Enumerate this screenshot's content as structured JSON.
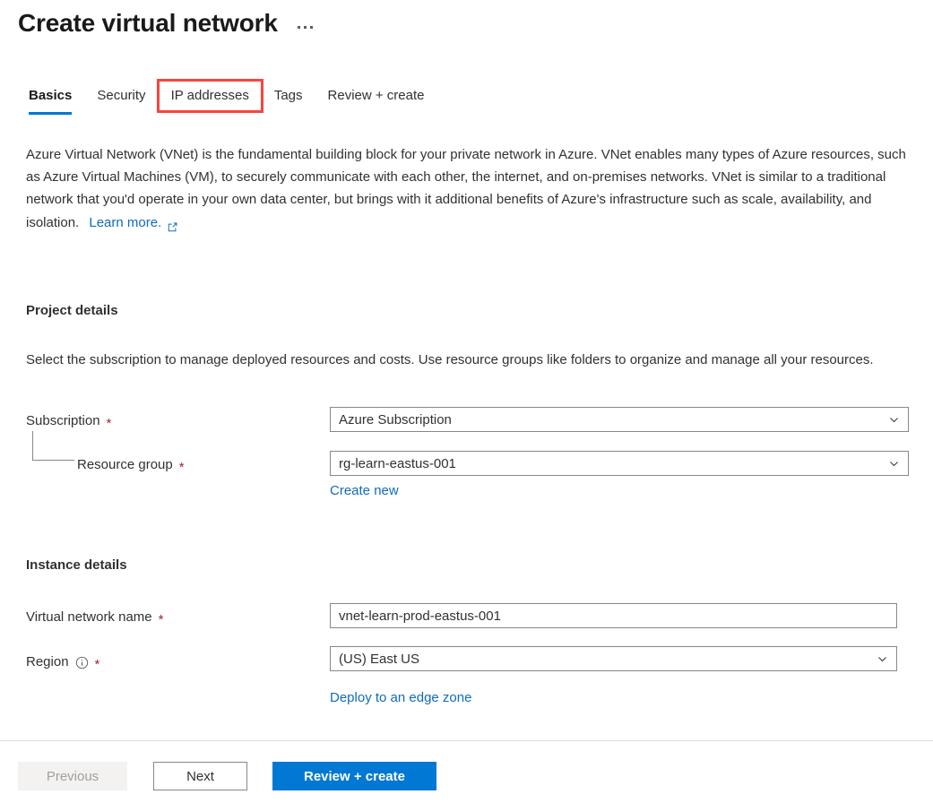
{
  "header": {
    "title": "Create virtual network",
    "more_menu_icon": "ellipsis-icon"
  },
  "tabs": [
    {
      "label": "Basics",
      "active": true,
      "highlighted": false
    },
    {
      "label": "Security",
      "active": false,
      "highlighted": false
    },
    {
      "label": "IP addresses",
      "active": false,
      "highlighted": true
    },
    {
      "label": "Tags",
      "active": false,
      "highlighted": false
    },
    {
      "label": "Review + create",
      "active": false,
      "highlighted": false
    }
  ],
  "intro": {
    "paragraph": "Azure Virtual Network (VNet) is the fundamental building block for your private network in Azure. VNet enables many types of Azure resources, such as Azure Virtual Machines (VM), to securely communicate with each other, the internet, and on-premises networks. VNet is similar to a traditional network that you'd operate in your own data center, but brings with it additional benefits of Azure's infrastructure such as scale, availability, and isolation.",
    "learn_more_label": "Learn more.",
    "learn_more_icon": "external-link-icon"
  },
  "project_details": {
    "heading": "Project details",
    "description": "Select the subscription to manage deployed resources and costs. Use resource groups like folders to organize and manage all your resources.",
    "subscription": {
      "label": "Subscription",
      "required_marker": "*",
      "value": "Azure Subscription",
      "chevron_icon": "chevron-down-icon"
    },
    "resource_group": {
      "label": "Resource group",
      "required_marker": "*",
      "value": "rg-learn-eastus-001",
      "chevron_icon": "chevron-down-icon",
      "create_new_label": "Create new"
    }
  },
  "instance_details": {
    "heading": "Instance details",
    "virtual_network_name": {
      "label": "Virtual network name",
      "required_marker": "*",
      "value": "vnet-learn-prod-eastus-001"
    },
    "region": {
      "label": "Region",
      "required_marker": "*",
      "info_icon": "info-icon",
      "value": "(US) East US",
      "chevron_icon": "chevron-down-icon",
      "edge_zone_label": "Deploy to an edge zone"
    }
  },
  "footer": {
    "previous_label": "Previous",
    "next_label": "Next",
    "review_create_label": "Review + create"
  },
  "colors": {
    "accent": "#0078d4",
    "link": "#0f6cbd",
    "required": "#a4262c",
    "highlight_box": "#f9443c",
    "border": "#8a8886"
  }
}
